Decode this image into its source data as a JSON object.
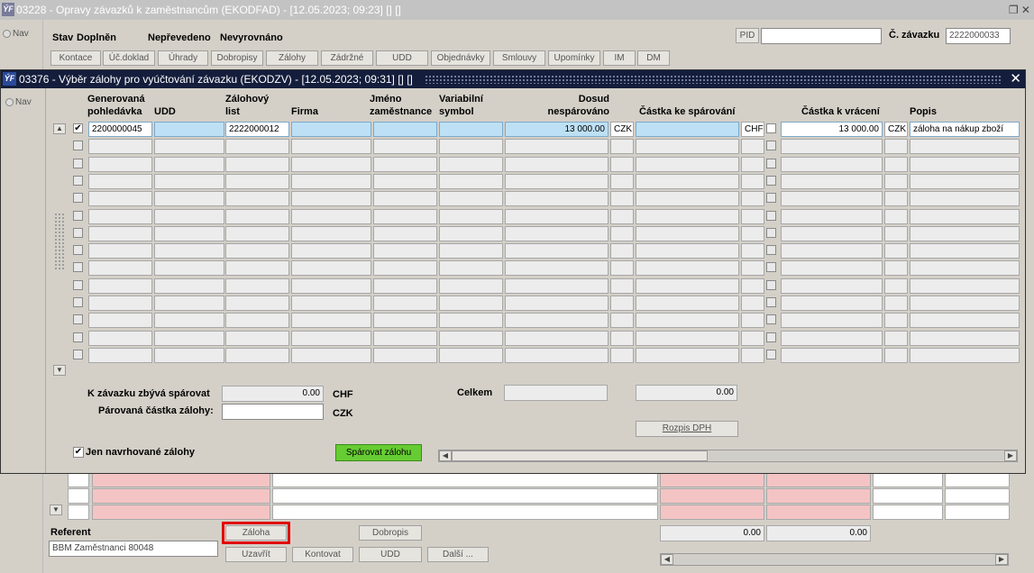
{
  "bg_title": "03228 - Opravy závazků k zaměstnancům (EKODFAD) - [12.05.2023; 09:23]  []  []",
  "nav_label": "Nav",
  "stav_label": "Stav",
  "stav_values": [
    "Doplněn",
    "Nepřevedeno",
    "Nevyrovnáno"
  ],
  "pid_label": "PID",
  "pid_value": "",
  "cislo_label": "Č. závazku",
  "cislo_value": "2222000033",
  "toolbar": [
    "Kontace",
    "Úč.doklad",
    "Úhrady",
    "Dobropisy",
    "Zálohy",
    "Zádržné",
    "UDD",
    "Objednávky",
    "Smlouvy",
    "Upomínky",
    "IM",
    "DM"
  ],
  "modal": {
    "title": "03376 - Výběr zálohy pro vyúčtování závazku (EKODZV) - [12.05.2023; 09:31]  []  []",
    "close": "✕",
    "nav_label": "Nav",
    "headers": {
      "gen": "Generovaná\npohledávka",
      "udd": "UDD",
      "zal": "Zálohový\nlist",
      "firma": "Firma",
      "jmeno": "Jméno\nzaměstnance",
      "vs": "Variabilní\nsymbol",
      "dosud": "Dosud\nnespárováno",
      "kspar": "Částka ke spárování",
      "kvrac": "Částka k vrácení",
      "popis": "Popis"
    },
    "row1": {
      "gen": "2200000045",
      "udd": "",
      "zal": "2222000012",
      "firma": "",
      "jmeno": "",
      "vs": "",
      "dosud": "13 000.00",
      "cur1": "CZK",
      "kspar": "",
      "cur2": "CHF",
      "kvrac": "13 000.00",
      "cur3": "CZK",
      "popis": "záloha na nákup zboží"
    },
    "zbyva_label": "K závazku zbývá spárovat",
    "zbyva_value": "0.00",
    "zbyva_cur": "CHF",
    "parovana_label": "Párovaná částka zálohy:",
    "parovana_value": "",
    "parovana_cur": "CZK",
    "celkem_label": "Celkem",
    "celkem_value": "",
    "celkem2_value": "0.00",
    "rozpis": "Rozpis DPH",
    "jen_label": "Jen navrhované zálohy",
    "sparovat": "Spárovat zálohu"
  },
  "referent_label": "Referent",
  "referent_value": "BBM Zaměstnanci 80048",
  "bottom_buttons": {
    "zaloha": "Záloha",
    "dobropis": "Dobropis",
    "uzavrit": "Uzavřít",
    "kontovat": "Kontovat",
    "udd": "UDD",
    "dalsi": "Další ..."
  },
  "sum1": "0.00",
  "sum2": "0.00",
  "colors": {
    "highlight": "#e00000",
    "green": "#66cc33",
    "pink": "#f4c4c4",
    "selected": "#bde0f5"
  }
}
